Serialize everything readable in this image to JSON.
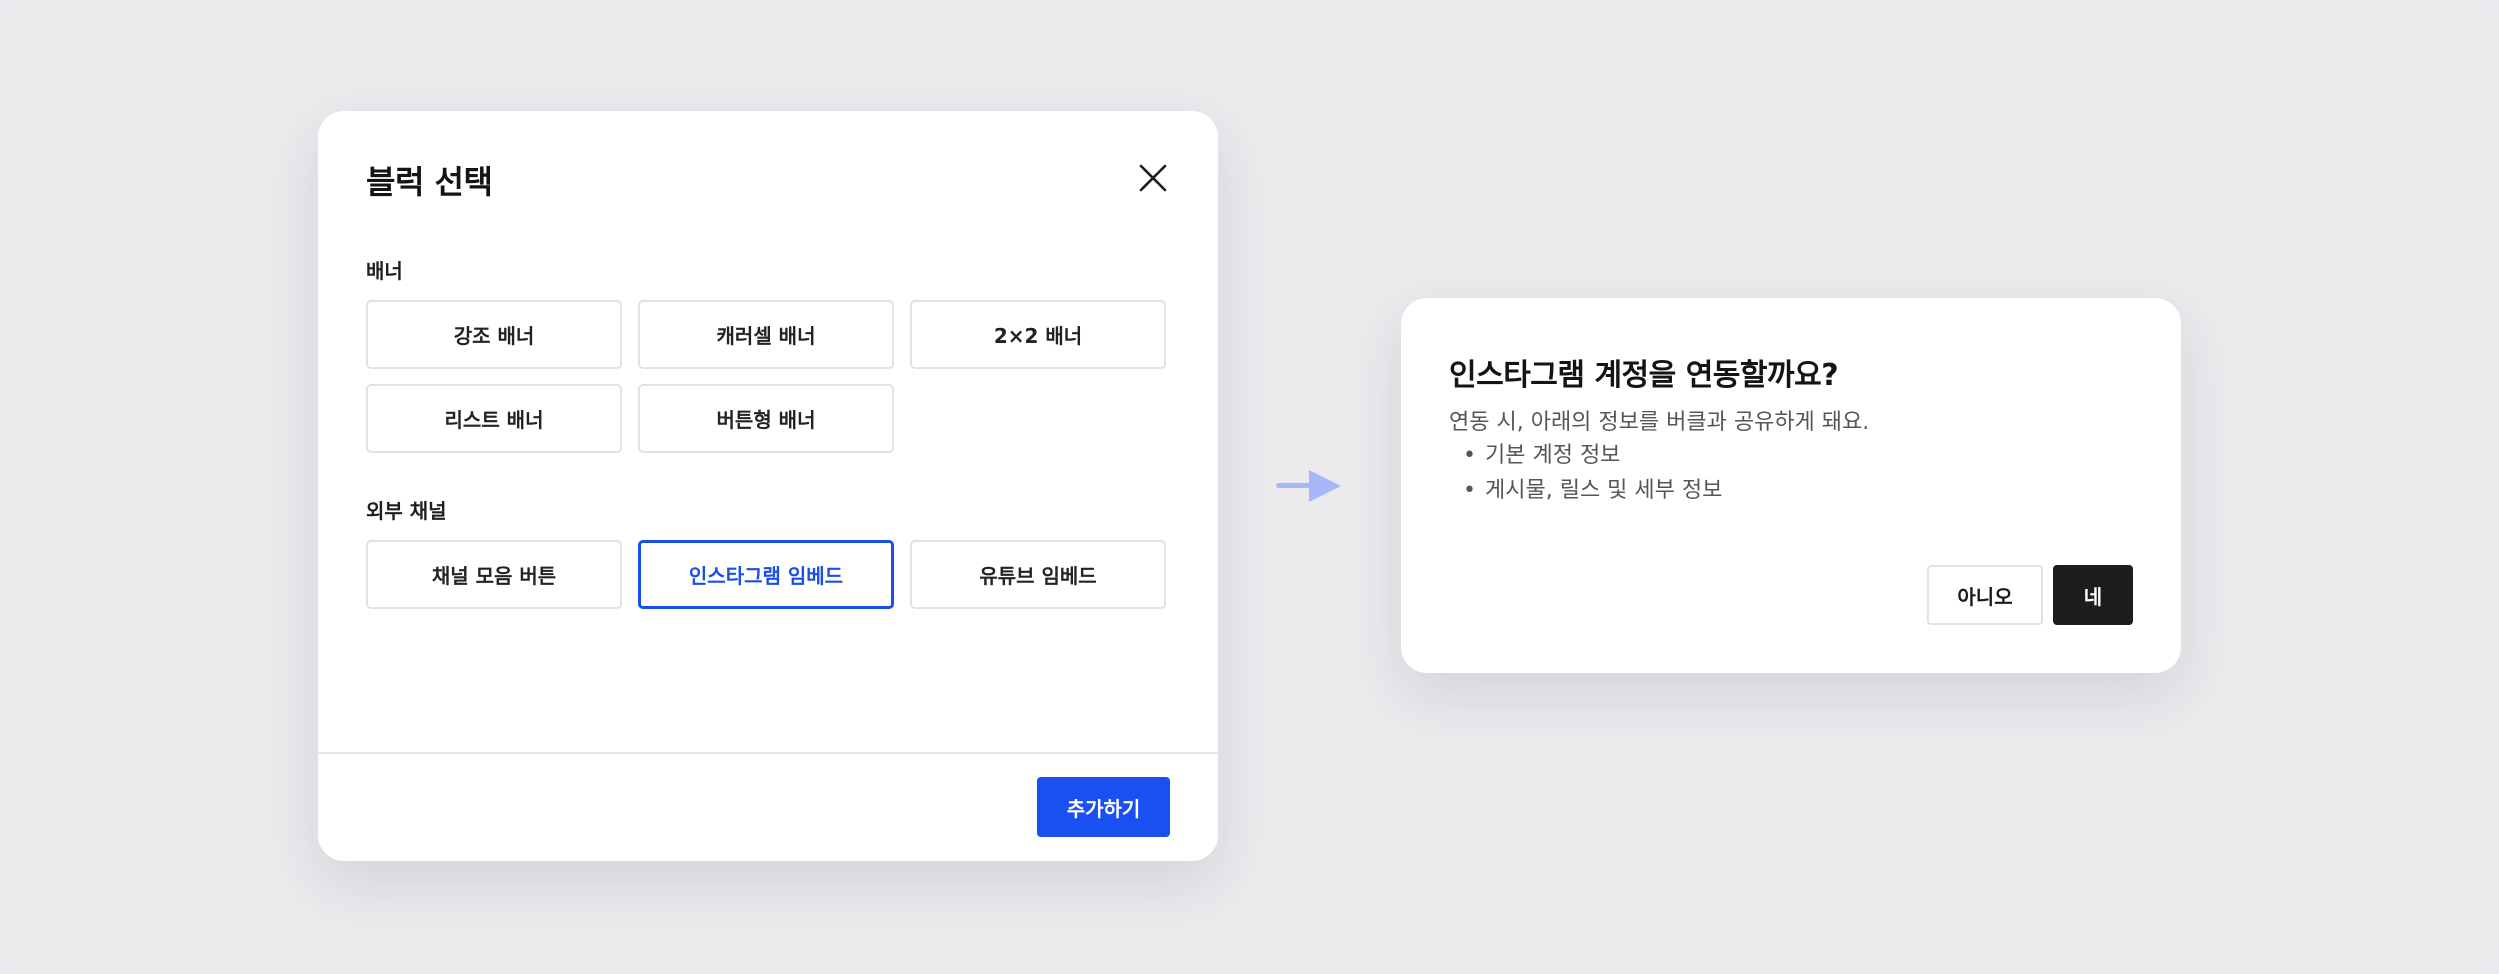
{
  "picker": {
    "title": "블럭 선택",
    "banner_section": {
      "label": "배너",
      "options": [
        "강조 배너",
        "캐러셀 배너",
        "2×2 배너",
        "리스트 배너",
        "버튼형 배너"
      ]
    },
    "external_section": {
      "label": "외부 채널",
      "options": [
        "채널 모음 버튼",
        "인스타그램 임베드",
        "유튜브 임베드"
      ],
      "selected": "인스타그램 임베드"
    },
    "add_label": "추가하기"
  },
  "dialog": {
    "title": "인스타그램 계정을 연동할까요?",
    "description": "연동 시, 아래의 정보를 버클과 공유하게 돼요.",
    "items": [
      "기본 계정 정보",
      "게시물, 릴스 및 세부 정보"
    ],
    "no_label": "아니오",
    "yes_label": "네"
  },
  "colors": {
    "accent": "#1a4ff0",
    "arrow": "#a6b8f7",
    "dark_button": "#1d1d20",
    "background": "#ebebee"
  },
  "icons": {
    "close": "close-icon",
    "flow": "arrow-right-icon"
  }
}
